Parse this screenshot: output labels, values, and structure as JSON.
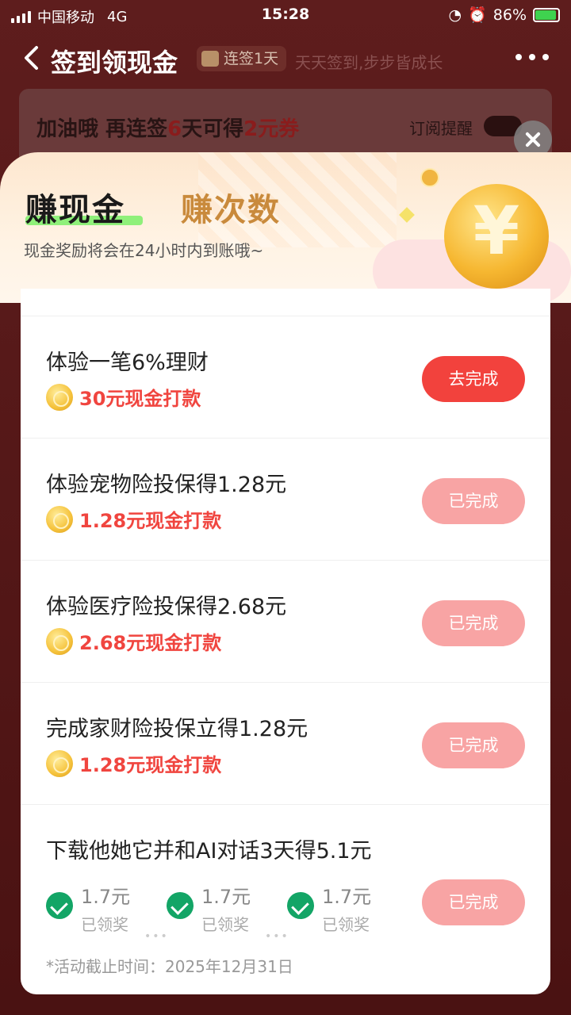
{
  "status_bar": {
    "carrier": "中国移动",
    "network": "4G",
    "time": "15:28",
    "battery": "86%",
    "battery_level": 0.86,
    "battery_color": "#3fd34f"
  },
  "nav": {
    "title": "签到领现金",
    "badge": "连签1天",
    "slogan": "天天签到,步步皆成长"
  },
  "bg_card": {
    "text_prefix": "加油哦 再连签",
    "days": "6",
    "text_mid": "天可得",
    "amount": "2元券",
    "subscribe_label": "订阅提醒"
  },
  "sheet": {
    "tab_cash": "赚现金",
    "tab_count": "赚次数",
    "tip": "现金奖励将会在24小时内到账哦~"
  },
  "tasks": [
    {
      "title": "体验一笔6%理财",
      "reward": "30元现金打款",
      "button": "去完成",
      "state": "active"
    },
    {
      "title": "体验宠物险投保得1.28元",
      "reward": "1.28元现金打款",
      "button": "已完成",
      "state": "done"
    },
    {
      "title": "体验医疗险投保得2.68元",
      "reward": "2.68元现金打款",
      "button": "已完成",
      "state": "done"
    },
    {
      "title": "完成家财险投保立得1.28元",
      "reward": "1.28元现金打款",
      "button": "已完成",
      "state": "done"
    },
    {
      "title": "下载他她它并和AI对话3天得5.1元",
      "button": "已完成",
      "state": "done",
      "steps": [
        {
          "amount": "1.7元",
          "label": "已领奖"
        },
        {
          "amount": "1.7元",
          "label": "已领奖"
        },
        {
          "amount": "1.7元",
          "label": "已领奖"
        }
      ],
      "deadline": "*活动截止时间：2025年12月31日"
    }
  ],
  "colors": {
    "accent_red": "#f2423d",
    "done_pink": "#f8a4a4",
    "reward_red": "#f0453f",
    "check_green": "#13a566"
  }
}
